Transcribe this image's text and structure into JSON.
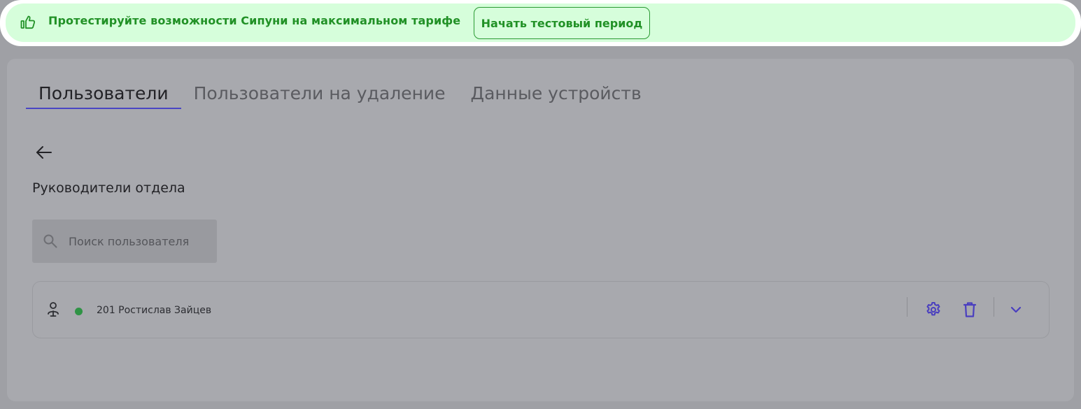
{
  "promo": {
    "text": "Протестируйте возможности Сипуни на максимальном тарифе",
    "button_label": "Начать тестовый период",
    "icon": "thumbs-up-icon",
    "accent_color": "#219126",
    "background_color": "#d6fedb"
  },
  "tabs": [
    {
      "label": "Пользователи",
      "active": true
    },
    {
      "label": "Пользователи на удаление",
      "active": false
    },
    {
      "label": "Данные устройств",
      "active": false
    }
  ],
  "section": {
    "title": "Руководители отдела"
  },
  "search": {
    "placeholder": "Поиск пользователя",
    "value": ""
  },
  "users": [
    {
      "name": "201 Ростислав Зайцев",
      "status": "online",
      "status_color": "#2f9345"
    }
  ],
  "icons": {
    "back": "arrow-left-icon",
    "search": "search-icon",
    "user": "user-icon",
    "settings": "gear-icon",
    "delete": "trash-icon",
    "expand": "chevron-down-icon"
  },
  "colors": {
    "tab_active_underline": "#4a46c4",
    "action_icons": "#4a3fbf"
  }
}
